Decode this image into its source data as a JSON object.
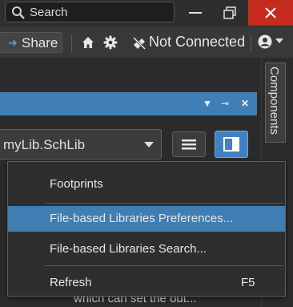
{
  "titlebar": {
    "search_placeholder": "Search",
    "close_color": "#c42b1c"
  },
  "toolbar": {
    "share_label": "Share",
    "connection_status": "Not Connected"
  },
  "right_panel": {
    "components_tab": "Components"
  },
  "panel": {
    "header_color": "#3f7fb5",
    "library_select_value": "myLib.SchLib",
    "background_text": "which can set the out..."
  },
  "menu": {
    "items": [
      {
        "label": "Footprints",
        "shortcut": ""
      },
      {
        "label": "File-based Libraries Preferences...",
        "shortcut": ""
      },
      {
        "label": "File-based Libraries Search...",
        "shortcut": ""
      },
      {
        "label": "Refresh",
        "shortcut": "F5"
      }
    ],
    "highlight_color": "#3e7eb2"
  },
  "icons": [
    "search-icon",
    "minimize-icon",
    "restore-icon",
    "close-icon",
    "share-arrow-icon",
    "home-icon",
    "gear-icon",
    "not-connected-icon",
    "user-icon",
    "chevron-down-icon",
    "hamburger-icon",
    "panel-layout-icon"
  ]
}
